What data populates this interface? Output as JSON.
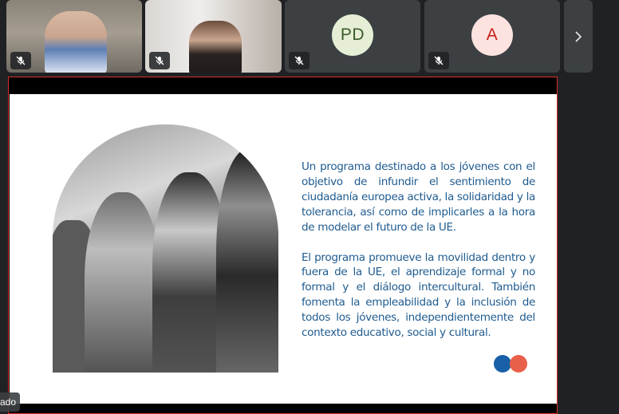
{
  "participants": [
    {
      "type": "video",
      "muted": true
    },
    {
      "type": "video",
      "muted": true
    },
    {
      "type": "avatar",
      "initials": "PD",
      "muted": true,
      "color": "#e6efd6",
      "text_color": "#3b5a2a"
    },
    {
      "type": "avatar",
      "initials": "A",
      "muted": true,
      "color": "#fce3df",
      "text_color": "#c5221f"
    }
  ],
  "strip": {
    "next_icon": "chevron-right-icon"
  },
  "slide": {
    "paragraph1": "Un programa destinado a los jóvenes con el objetivo de infundir el sentimiento de ciudadanía europea activa, la solidaridad y la tolerancia, así como de implicarles a la hora de modelar el futuro de la UE.",
    "paragraph2": "El programa promueve la movilidad dentro y fuera de la UE, el aprendizaje formal y no formal y el diálogo intercultural. También fomenta la empleabilidad y la inclusión de todos los jóvenes, independientemente del contexto educativo, social y cultural.",
    "text_color": "#1f5b8f",
    "logo_colors": [
      "#1a60a8",
      "#e9604a"
    ]
  },
  "presenter_label": "ado"
}
